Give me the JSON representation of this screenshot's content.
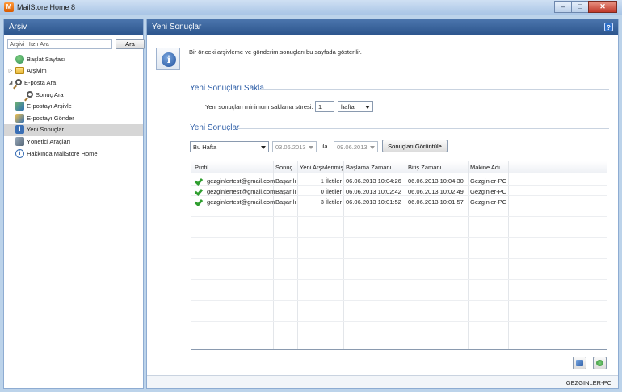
{
  "window": {
    "title": "MailStore Home 8",
    "app_icon": "mailstore-logo-icon",
    "buttons": [
      "–",
      "□",
      "✕"
    ]
  },
  "left": {
    "header": "Arşiv",
    "search": {
      "placeholder": "Arşivi Hızlı Ara",
      "button": "Ara"
    },
    "tree": [
      {
        "label": "Başlat Sayfası",
        "icon": "home-icon",
        "level": 0,
        "expander": ""
      },
      {
        "label": "Arşivim",
        "icon": "folder-icon",
        "level": 0,
        "expander": "▷"
      },
      {
        "label": "E-posta Ara",
        "icon": "search-icon",
        "level": 0,
        "expander": "◢"
      },
      {
        "label": "Sonuç Ara",
        "icon": "search-icon",
        "level": 1,
        "expander": ""
      },
      {
        "label": "E-postayı Arşivle",
        "icon": "archive-icon",
        "level": 0,
        "expander": ""
      },
      {
        "label": "E-postayı Gönder",
        "icon": "send-icon",
        "level": 0,
        "expander": ""
      },
      {
        "label": "Yeni Sonuçlar",
        "icon": "info-icon",
        "level": 0,
        "expander": "",
        "selected": true
      },
      {
        "label": "Yönetici Araçları",
        "icon": "tools-icon",
        "level": 0,
        "expander": ""
      },
      {
        "label": "Hakkında MailStore Home",
        "icon": "about-icon",
        "level": 0,
        "expander": ""
      }
    ]
  },
  "right": {
    "header": "Yeni Sonuçlar",
    "help": "?",
    "description": "Bir önceki arşivleme ve gönderim sonuçları bu sayfada gösterilir.",
    "keep": {
      "section": "Yeni Sonuçları Sakla",
      "label": "Yeni sonuçları minimum saklama süresi:",
      "value": "1",
      "unit": "hafta"
    },
    "results": {
      "section": "Yeni Sonuçlar",
      "period": "Bu Hafta",
      "from": "03.06.2013",
      "to_label": "ila",
      "to": "09.06.2013",
      "show_button": "Sonuçları Görüntüle"
    },
    "table": {
      "columns": [
        "Profil",
        "Sonuç",
        "Yeni Arşivlenmiş",
        "Başlama Zamanı",
        "Bitiş Zamanı",
        "Makine Adı"
      ],
      "rows": [
        {
          "profile": "gezginlertest@gmail.com",
          "result": "Başarılı",
          "count": "1 İletiler",
          "start": "06.06.2013 10:04:26",
          "end": "06.06.2013 10:04:30",
          "machine": "Gezginler-PC"
        },
        {
          "profile": "gezginlertest@gmail.com",
          "result": "Başarılı",
          "count": "0 İletiler",
          "start": "06.06.2013 10:02:42",
          "end": "06.06.2013 10:02:49",
          "machine": "Gezginler-PC"
        },
        {
          "profile": "gezginlertest@gmail.com",
          "result": "Başarılı",
          "count": "3 İletiler",
          "start": "06.06.2013 10:01:52",
          "end": "06.06.2013 10:01:57",
          "machine": "Gezginler-PC"
        }
      ]
    },
    "status": "GEZGINLER-PC"
  }
}
